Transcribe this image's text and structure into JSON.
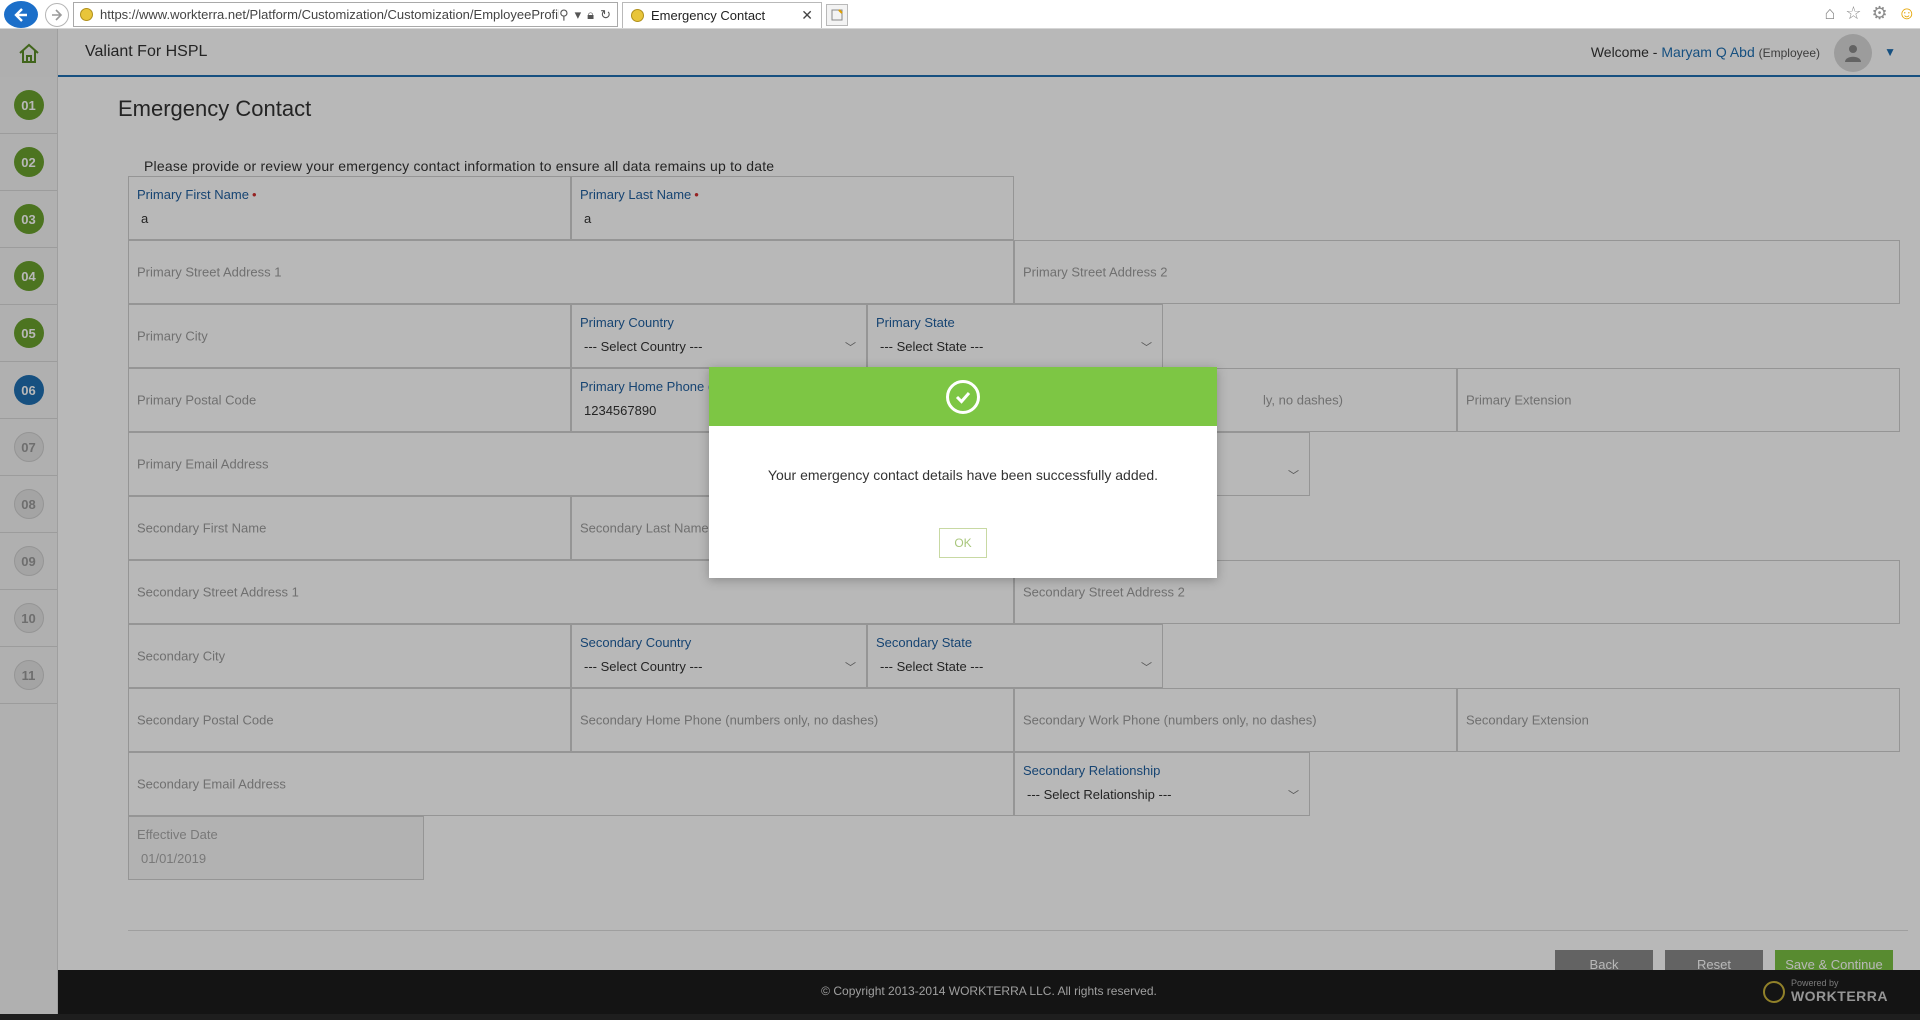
{
  "browser": {
    "url": "https://www.workterra.net/Platform/Customization/Customization/EmployeeProfile",
    "tab_title": "Emergency Contact"
  },
  "header": {
    "app_title": "Valiant For HSPL",
    "welcome_label": "Welcome -",
    "user_name": "Maryam Q Abd",
    "user_role": "(Employee)"
  },
  "steps": [
    "01",
    "02",
    "03",
    "04",
    "05",
    "06",
    "07",
    "08",
    "09",
    "10",
    "11"
  ],
  "page": {
    "title": "Emergency Contact",
    "intro": "Please provide or review your emergency contact information to ensure all data remains up to date"
  },
  "form": {
    "primary_first_name_label": "Primary First Name",
    "primary_first_name_value": "a",
    "primary_last_name_label": "Primary Last Name",
    "primary_last_name_value": "a",
    "primary_street1_ph": "Primary Street Address 1",
    "primary_street2_ph": "Primary Street Address 2",
    "primary_city_ph": "Primary City",
    "primary_country_label": "Primary Country",
    "primary_country_value": "--- Select Country ---",
    "primary_state_label": "Primary State",
    "primary_state_value": "--- Select State ---",
    "primary_postal_ph": "Primary Postal Code",
    "primary_home_phone_label": "Primary Home Phone (",
    "primary_home_phone_value": "1234567890",
    "primary_work_phone_partial": "ly, no dashes)",
    "primary_extension_ph": "Primary Extension",
    "primary_email_ph": "Primary Email Address",
    "secondary_first_name_ph": "Secondary First Name",
    "secondary_last_name_ph": "Secondary Last Name",
    "secondary_street1_ph": "Secondary Street Address 1",
    "secondary_street2_ph": "Secondary Street Address 2",
    "secondary_city_ph": "Secondary City",
    "secondary_country_label": "Secondary Country",
    "secondary_country_value": "--- Select Country ---",
    "secondary_state_label": "Secondary State",
    "secondary_state_value": "--- Select State ---",
    "secondary_postal_ph": "Secondary Postal Code",
    "secondary_home_phone_ph": "Secondary Home Phone (numbers only, no dashes)",
    "secondary_work_phone_ph": "Secondary Work Phone (numbers only, no dashes)",
    "secondary_extension_ph": "Secondary Extension",
    "secondary_email_ph": "Secondary Email Address",
    "secondary_relationship_label": "Secondary Relationship",
    "secondary_relationship_value": "--- Select Relationship ---",
    "effective_date_label": "Effective Date",
    "effective_date_value": "01/01/2019"
  },
  "buttons": {
    "back": "Back",
    "reset": "Reset",
    "save": "Save & Continue"
  },
  "footer": {
    "copyright": "© Copyright 2013-2014 WORKTERRA LLC. All rights reserved.",
    "powered_by": "Powered by",
    "brand": "WORKTERRA"
  },
  "modal": {
    "message": "Your emergency contact details have been successfully added.",
    "ok_label": "OK"
  },
  "colors": {
    "accent_blue": "#1f6fb2",
    "success_green": "#7dc644",
    "step_done": "#6aa12d"
  }
}
